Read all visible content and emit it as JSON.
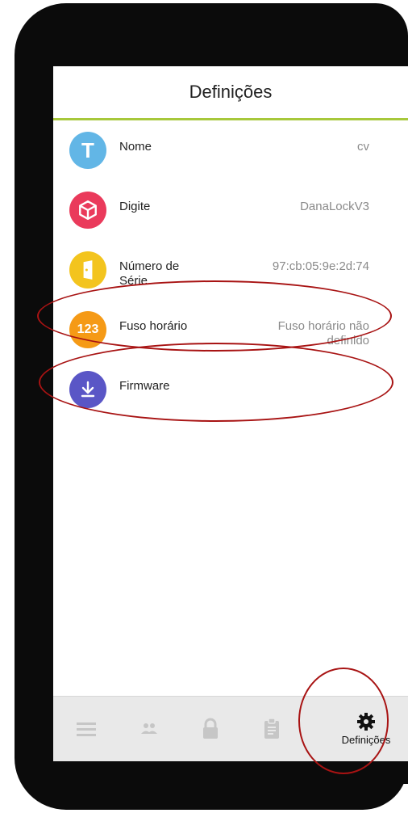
{
  "header": {
    "title": "Definições"
  },
  "settings": {
    "items": [
      {
        "key": "nome",
        "label": "Nome",
        "value": "cv",
        "icon_text": "T",
        "color": "#62b6e6",
        "icon": "text-icon"
      },
      {
        "key": "digite",
        "label": "Digite",
        "value": "DanaLockV3",
        "icon_text": "",
        "color": "#ea3a5b",
        "icon": "cube-icon"
      },
      {
        "key": "serie",
        "label": "Número de Série",
        "value": "97:cb:05:9e:2d:74",
        "icon_text": "",
        "color": "#f3c41e",
        "icon": "door-icon"
      },
      {
        "key": "fuso",
        "label": "Fuso horário",
        "value": "Fuso horário não definido",
        "icon_text": "123",
        "color": "#f59a16",
        "icon": "number-icon"
      },
      {
        "key": "firmware",
        "label": "Firmware",
        "value": "",
        "icon_text": "",
        "color": "#5a56c6",
        "icon": "download-icon"
      }
    ]
  },
  "nav": {
    "active": "Definições",
    "items": [
      "menu-icon",
      "users-icon",
      "lock-icon",
      "clipboard-icon",
      "gear-icon"
    ]
  },
  "colors": {
    "accent": "#a7c83b",
    "annotation": "#a81313",
    "nav_bg": "#e9e9e9",
    "inactive_icon": "#c6c6c6"
  }
}
